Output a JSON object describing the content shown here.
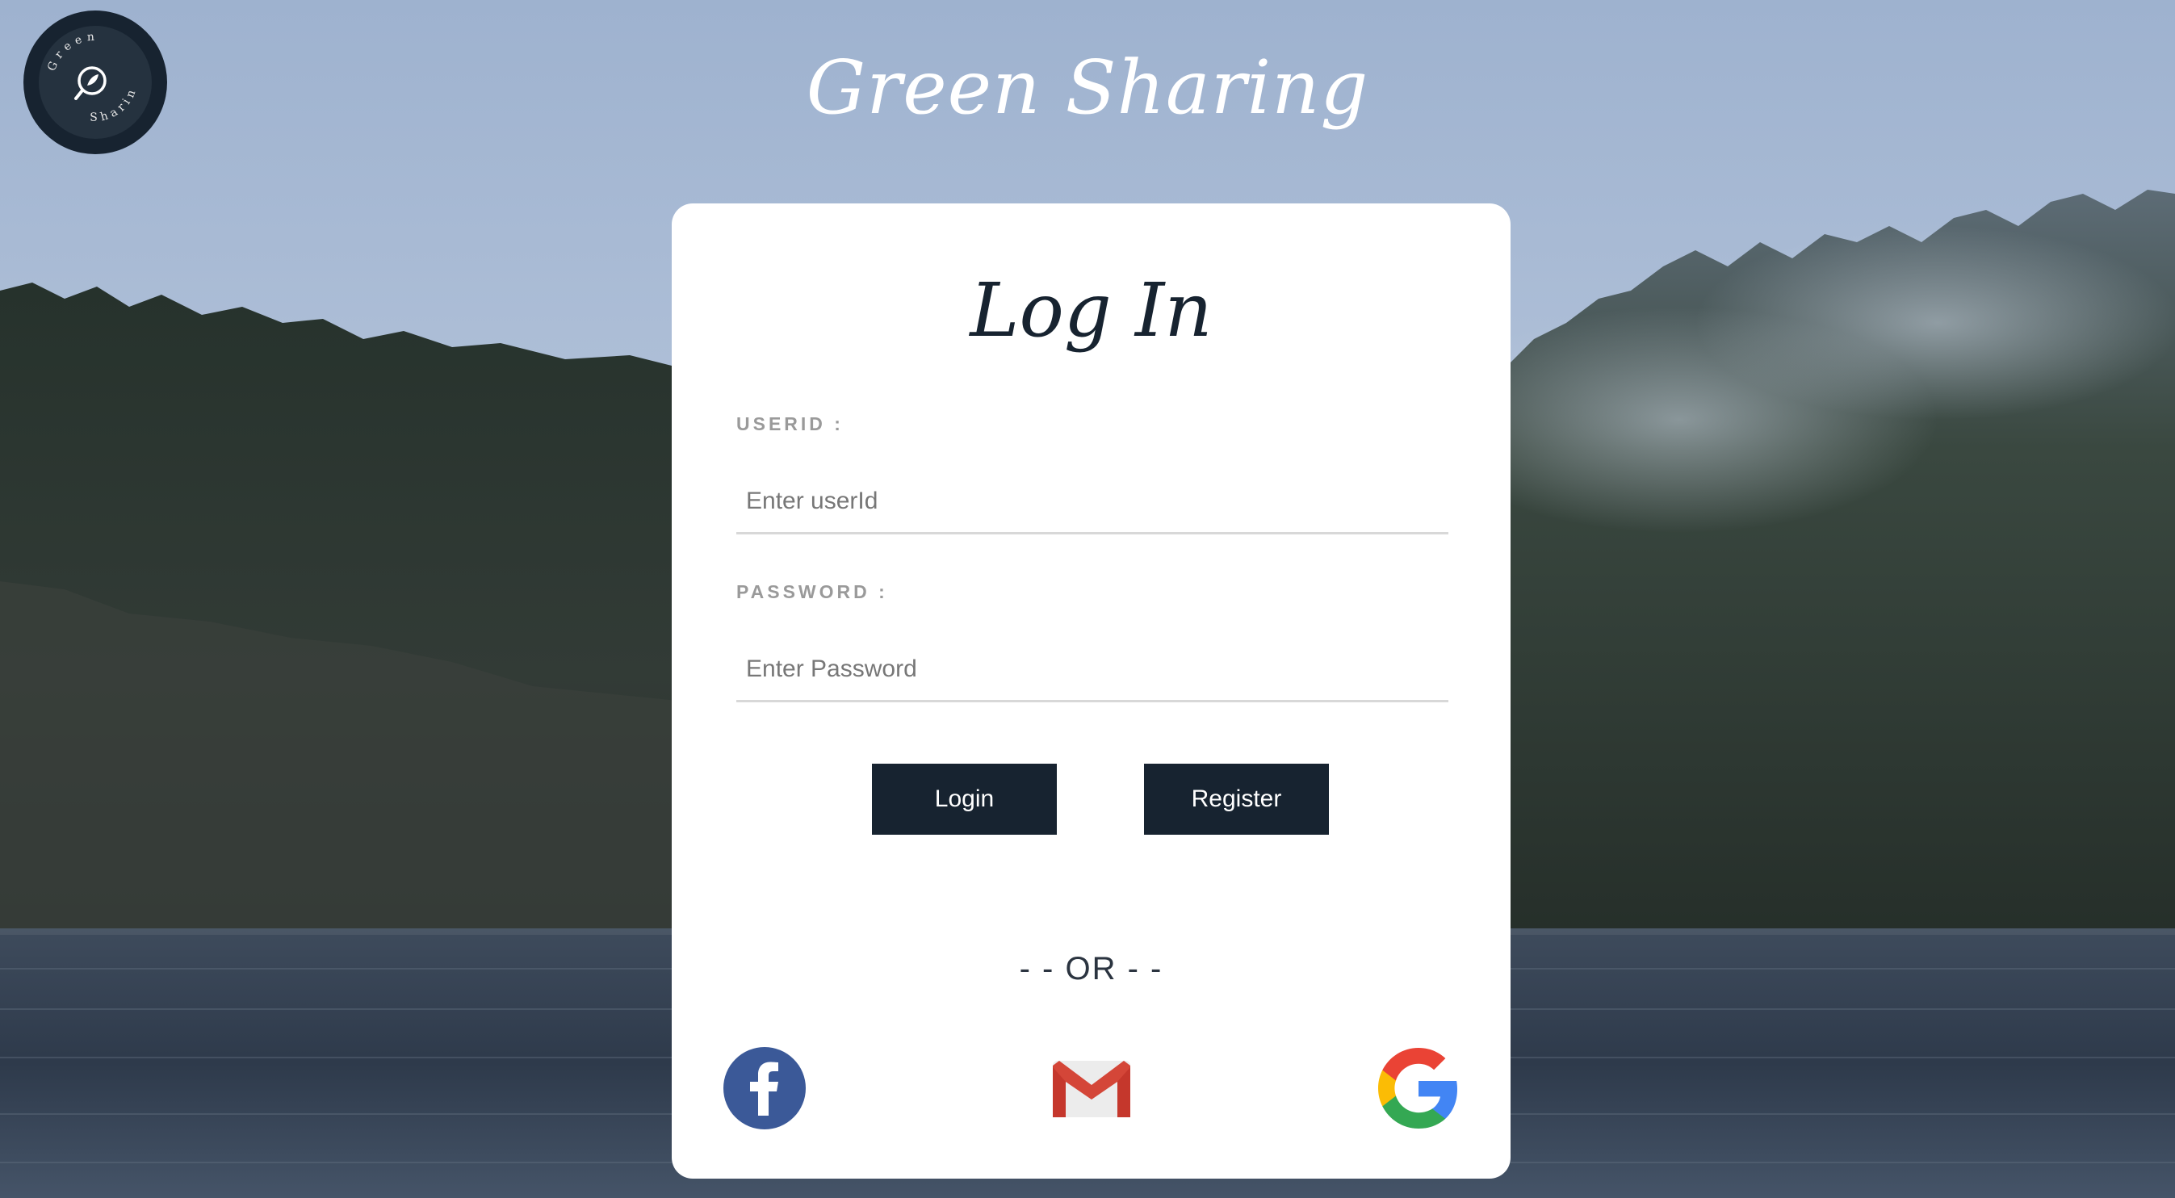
{
  "brand": {
    "title": "Green Sharing",
    "logo_text_top": "Green",
    "logo_text_bottom": "Sharing"
  },
  "login_card": {
    "title": "Log In",
    "userid_label": "USERID :",
    "userid_placeholder": "Enter userId",
    "password_label": "PASSWORD :",
    "password_placeholder": "Enter Password",
    "login_button": "Login",
    "register_button": "Register",
    "or_text": "- - OR - -"
  },
  "social_icons": [
    "facebook-icon",
    "gmail-icon",
    "google-icon"
  ],
  "colors": {
    "primary_dark": "#172330",
    "card_bg": "#ffffff",
    "label_gray": "#9a9a9a",
    "facebook_blue": "#3b5998",
    "gmail_red": "#d44638"
  }
}
